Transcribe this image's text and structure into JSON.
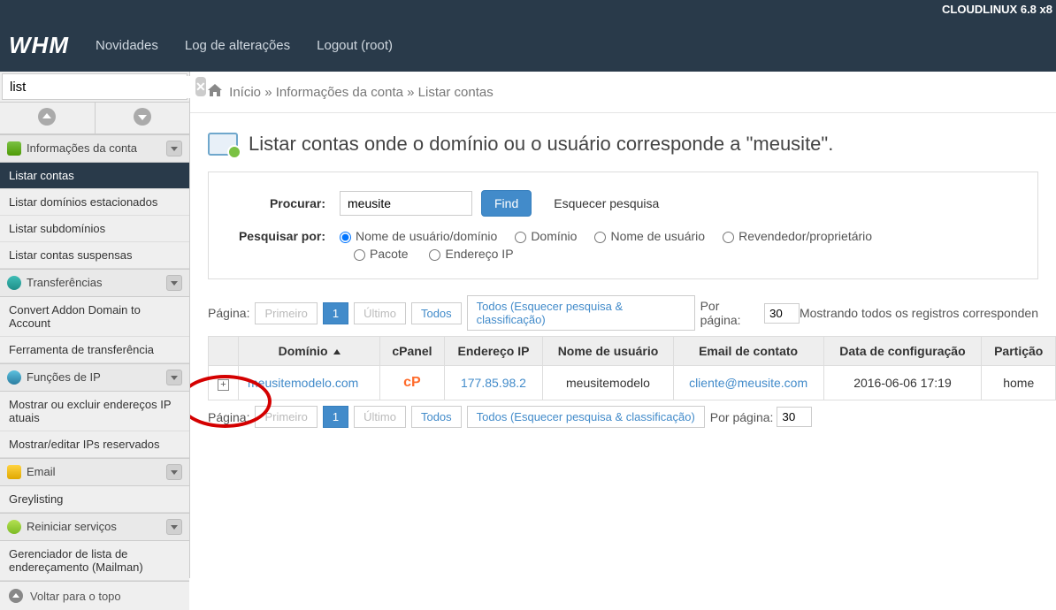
{
  "os_bar": "CLOUDLINUX 6.8 x8",
  "logo": "WHM",
  "top_nav": {
    "news": "Novidades",
    "changelog": "Log de alterações",
    "logout": "Logout (root)"
  },
  "search": {
    "value": "list"
  },
  "breadcrumb": {
    "home": "Início",
    "sep": "»",
    "info": "Informações da conta",
    "current": "Listar contas"
  },
  "page_title": "Listar contas onde o domínio ou o usuário corresponde a \"meusite\".",
  "sidebar": {
    "group_info": "Informações da conta",
    "items_info": [
      "Listar contas",
      "Listar domínios estacionados",
      "Listar subdomínios",
      "Listar contas suspensas"
    ],
    "group_transfer": "Transferências",
    "items_transfer": [
      "Convert Addon Domain to Account",
      "Ferramenta de transferência"
    ],
    "group_ip": "Funções de IP",
    "items_ip": [
      "Mostrar ou excluir endereços IP atuais",
      "Mostrar/editar IPs reservados"
    ],
    "group_email": "Email",
    "items_email": [
      "Greylisting"
    ],
    "group_restart": "Reiniciar serviços",
    "items_restart": [
      "Gerenciador de lista de endereçamento (Mailman)"
    ],
    "back_top": "Voltar para o topo"
  },
  "search_panel": {
    "search_label": "Procurar:",
    "search_value": "meusite",
    "find": "Find",
    "forget": "Esquecer pesquisa",
    "by_label": "Pesquisar por:",
    "opts": [
      "Nome de usuário/domínio",
      "Domínio",
      "Nome de usuário",
      "Revendedor/proprietário",
      "Pacote",
      "Endereço IP"
    ]
  },
  "pager": {
    "page_label": "Página:",
    "first": "Primeiro",
    "current": "1",
    "last": "Último",
    "all": "Todos",
    "all_reset": "Todos (Esquecer pesquisa & classificação)",
    "per_page_label": "Por página:",
    "per_page": "30",
    "showing": "Mostrando todos os registros corresponden"
  },
  "table": {
    "headers": {
      "domain": "Domínio",
      "cpanel": "cPanel",
      "ip": "Endereço IP",
      "user": "Nome de usuário",
      "email": "Email de contato",
      "date": "Data de configuração",
      "partition": "Partição"
    },
    "rows": [
      {
        "domain": "meusitemodelo.com",
        "ip": "177.85.98.2",
        "user": "meusitemodelo",
        "email": "cliente@meusite.com",
        "date": "2016-06-06 17:19",
        "partition": "home"
      }
    ]
  }
}
